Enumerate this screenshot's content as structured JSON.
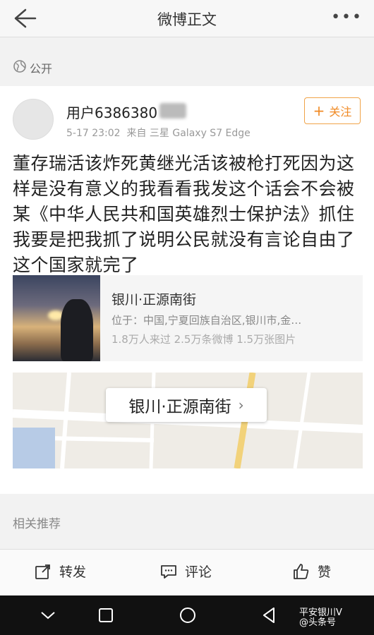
{
  "header": {
    "title": "微博正文",
    "back_icon": "back-arrow-icon",
    "more_icon": "more-dots-icon"
  },
  "visibility": {
    "label": "公开",
    "icon": "globe-icon"
  },
  "post": {
    "username": "用户6386380",
    "timestamp": "5-17 23:02",
    "source": "来自 三星 Galaxy S7 Edge",
    "follow_label": "关注",
    "text": "董存瑞活该炸死黄继光活该被枪打死因为这样是没有意义的我看看我发这个话会不会被某《中华人民共和国英雄烈士保护法》抓住我要是把我抓了说明公民就没有言论自由了这个国家就完了"
  },
  "location": {
    "name": "银川·正源南街",
    "address": "位于：中国,宁夏回族自治区,银川市,金…",
    "stats": "1.8万人来过 2.5万条微博 1.5万张图片"
  },
  "map": {
    "label": "银川·正源南街"
  },
  "recommend": {
    "label": "相关推荐"
  },
  "actions": {
    "repost": "转发",
    "comment": "评论",
    "like": "赞"
  },
  "watermark": {
    "line1": "平安银川V",
    "line2": "@头条号"
  },
  "colors": {
    "accent": "#f08a24",
    "text": "#222222",
    "muted": "#999999"
  }
}
